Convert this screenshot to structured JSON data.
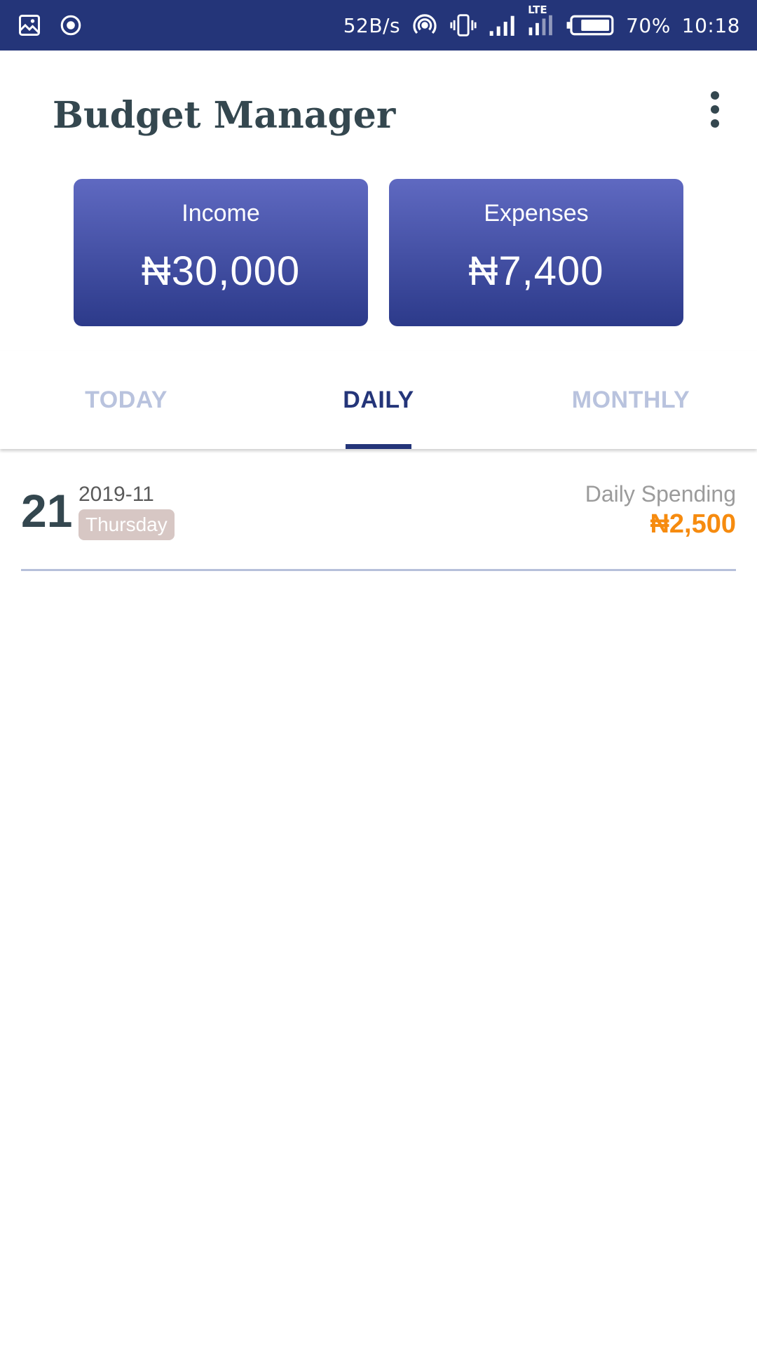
{
  "status_bar": {
    "left_icons": [
      "image-icon",
      "target-icon"
    ],
    "net_speed": "52B/s",
    "network_type": "LTE",
    "battery": "70%",
    "time": "10:18"
  },
  "header": {
    "title": "Budget Manager",
    "menu_icon": "more-vertical-icon"
  },
  "summary": {
    "income": {
      "label": "Income",
      "value": "₦30,000"
    },
    "expenses": {
      "label": "Expenses",
      "value": "₦7,400"
    }
  },
  "tabs": {
    "items": [
      {
        "label": "TODAY"
      },
      {
        "label": "DAILY"
      },
      {
        "label": "MONTHLY"
      }
    ],
    "selected": "DAILY"
  },
  "daily_entries": [
    {
      "day": "21",
      "month": "2019-11",
      "weekday": "Thursday",
      "spending_label": "Daily Spending",
      "spending_value": "₦2,500"
    }
  ],
  "colors": {
    "status_bar": "#243579",
    "accent": "#243579",
    "card_gradient_top": "#5f69c1",
    "card_gradient_bottom": "#2c3a8a",
    "inactive_tab": "#b9c3de",
    "spending": "#f68b0f",
    "weekday_badge": "#d7c7c4",
    "title_text": "#34474f"
  }
}
